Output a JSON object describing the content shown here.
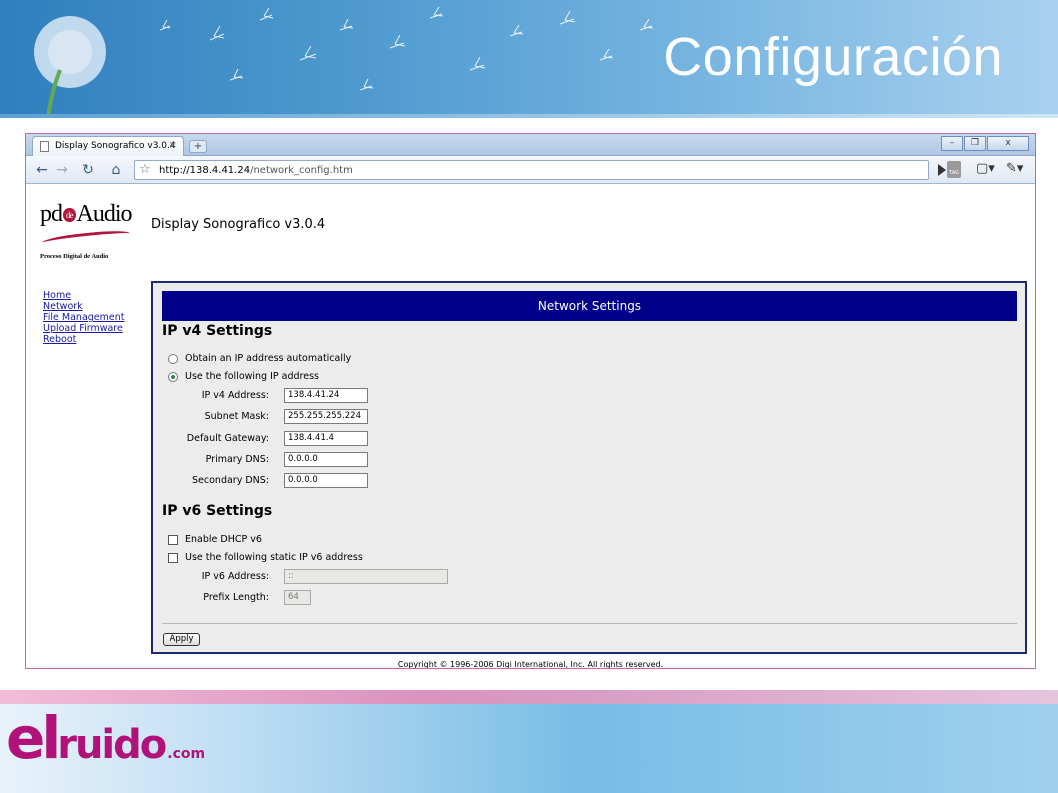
{
  "slide": {
    "title": "Configuración",
    "brand": {
      "el": "el",
      "ruido": "ruido",
      "com": ".com"
    }
  },
  "browser": {
    "tab_title": "Display Sonografico v3.0.4",
    "tab_close": "×",
    "new_tab": "+",
    "url_host": "http://138.4.41.24",
    "url_path": "/network_config.htm",
    "window_controls": {
      "minimize": "–",
      "maximize": "❐",
      "close": "x"
    },
    "tag_label": "TAG"
  },
  "page": {
    "logo": {
      "text_left": "pd",
      "text_de": "de",
      "text_right": "Audio",
      "subtitle": "Proceso Digital de Audio"
    },
    "heading": "Display Sonografico v3.0.4",
    "nav": [
      "Home",
      "Network",
      "File Management",
      "Upload Firmware",
      "Reboot"
    ],
    "panel_title": "Network Settings",
    "ipv4": {
      "title": "IP v4 Settings",
      "option_auto": "Obtain an IP address automatically",
      "option_static": "Use the following IP address",
      "fields": [
        {
          "label": "IP v4 Address:",
          "value": "138.4.41.24"
        },
        {
          "label": "Subnet Mask:",
          "value": "255.255.255.224"
        },
        {
          "label": "Default Gateway:",
          "value": "138.4.41.4"
        },
        {
          "label": "Primary DNS:",
          "value": "0.0.0.0"
        },
        {
          "label": "Secondary DNS:",
          "value": "0.0.0.0"
        }
      ]
    },
    "ipv6": {
      "title": "IP v6 Settings",
      "enable_dhcp": "Enable DHCP v6",
      "use_static": "Use the following static IP v6 address",
      "address_label": "IP v6 Address:",
      "address_value": "::",
      "prefix_label": "Prefix Length:",
      "prefix_value": "64"
    },
    "apply_label": "Apply",
    "copyright": "Copyright © 1996-2006 Digi International, Inc. All rights reserved."
  }
}
